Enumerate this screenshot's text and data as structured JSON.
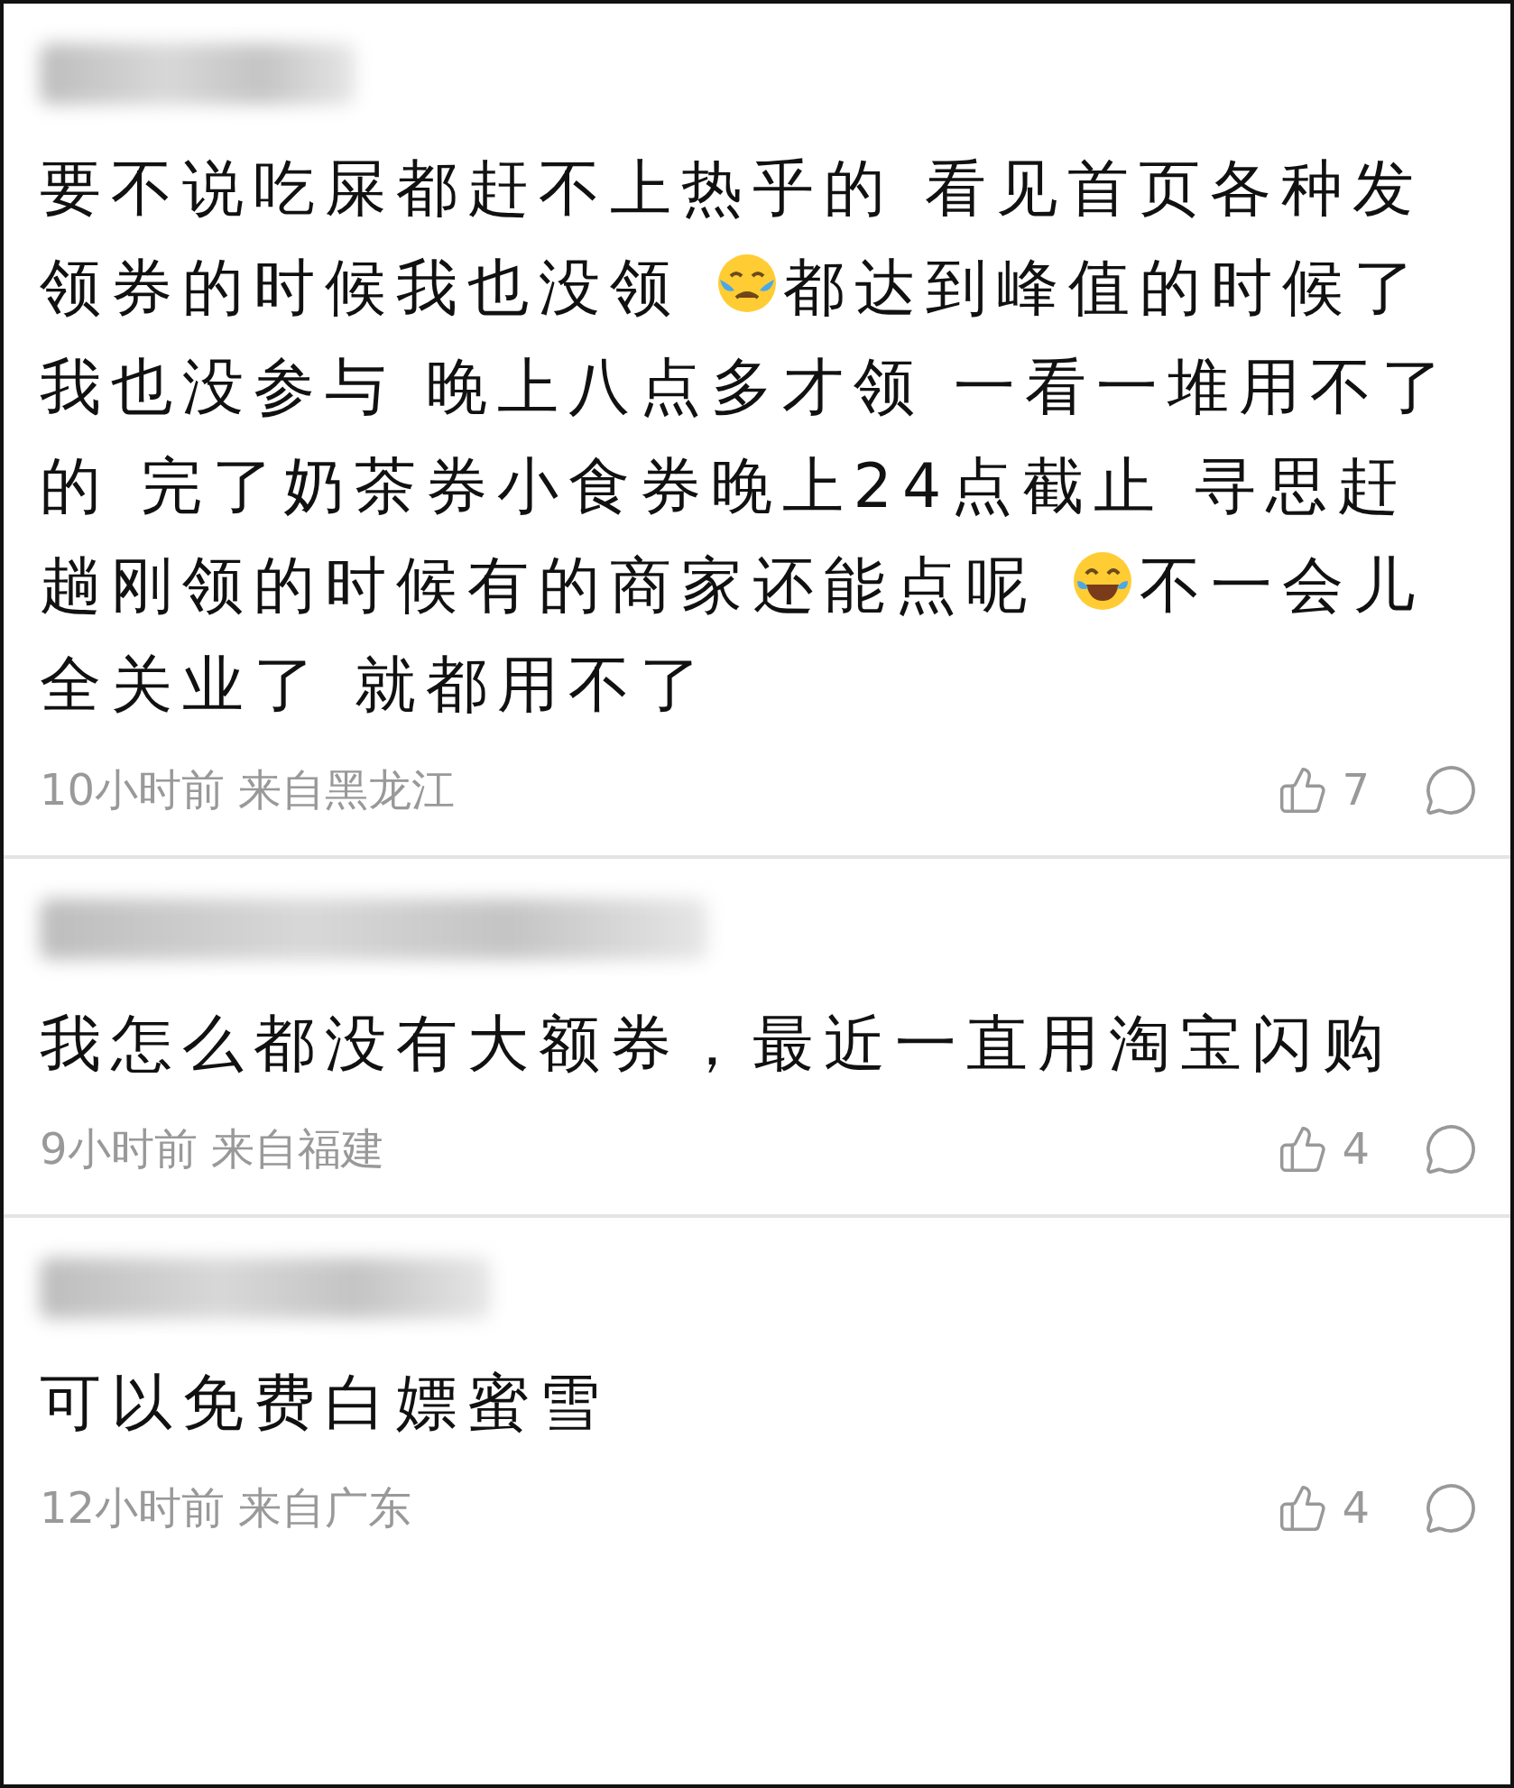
{
  "comments": [
    {
      "segments": [
        {
          "kind": "text",
          "text": "要不说吃屎都赶不上热乎的 看见首页各种发领券的时候我也没领 "
        },
        {
          "kind": "cry_emoji"
        },
        {
          "kind": "text",
          "text": "都达到峰值的时候了我也没参与 晚上八点多才领 一看一堆用不了的 完了奶茶券小食券晚上24点截止 寻思赶趟刚领的时候有的商家还能点呢 "
        },
        {
          "kind": "laugh_emoji"
        },
        {
          "kind": "text",
          "text": "不一会儿全关业了 就都用不了"
        }
      ],
      "meta": "10小时前 来自黑龙江",
      "likes": "7"
    },
    {
      "segments": [
        {
          "kind": "text",
          "text": "我怎么都没有大额券，最近一直用淘宝闪购"
        }
      ],
      "meta": "9小时前 来自福建",
      "likes": "4"
    },
    {
      "segments": [
        {
          "kind": "text",
          "text": "可以免费白嫖蜜雪"
        }
      ],
      "meta": "12小时前 来自广东",
      "likes": "4"
    }
  ]
}
